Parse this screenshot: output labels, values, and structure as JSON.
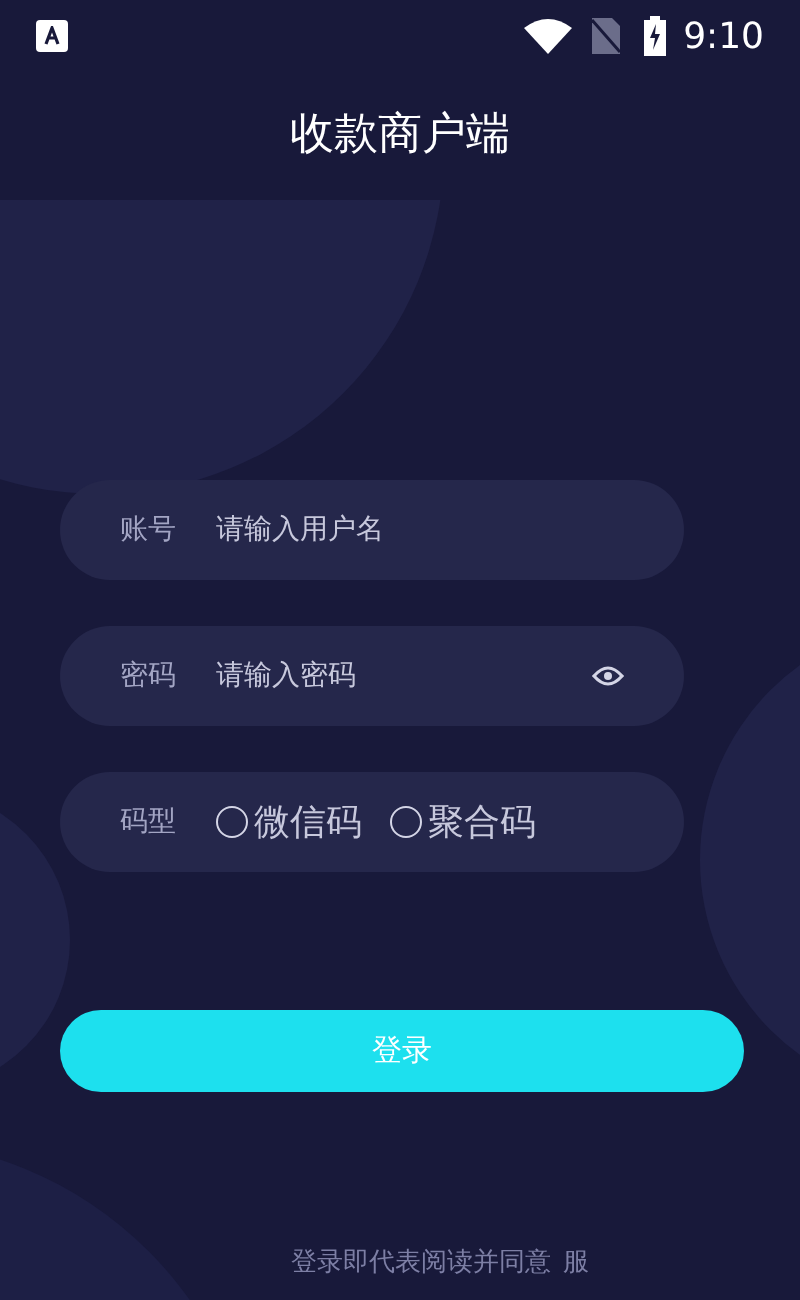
{
  "status_bar": {
    "time": "9:10"
  },
  "title": "收款商户端",
  "fields": [
    {
      "kind": "text",
      "label": "账号",
      "placeholder": "请输入用户名"
    },
    {
      "kind": "password",
      "label": "密码",
      "placeholder": "请输入密码"
    },
    {
      "kind": "radio",
      "label": "码型",
      "options": [
        {
          "label": "微信码",
          "selected": false
        },
        {
          "label": "聚合码",
          "selected": false
        }
      ]
    }
  ],
  "login_button": "登录",
  "footer": {
    "text": "登录即代表阅读并同意",
    "link": "服"
  }
}
